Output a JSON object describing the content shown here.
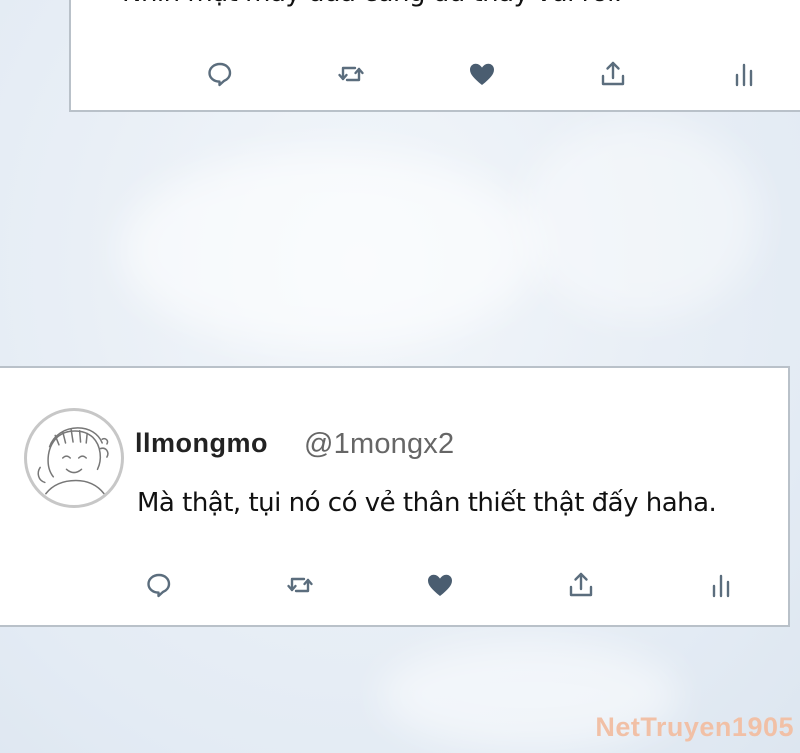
{
  "colors": {
    "card_border": "#b9c1c9",
    "icon": "#5b6d7d",
    "heart": "#4a5d70",
    "name": "#222222",
    "handle": "#666666",
    "watermark": "#f1c0a6"
  },
  "top_tweet": {
    "text": "Nhìn mặt mấy đứa cũng đủ thấy vui rồi.",
    "actions": [
      "reply-icon",
      "retweet-icon",
      "like-icon",
      "share-icon",
      "analytics-icon"
    ]
  },
  "reply_tweet": {
    "display_name": "llmongmo",
    "handle": "@1mongx2",
    "text": "Mà thật, tụi nó có vẻ thân thiết thật đấy haha.",
    "actions": [
      "reply-icon",
      "retweet-icon",
      "like-icon",
      "share-icon",
      "analytics-icon"
    ]
  },
  "watermark": "NetTruyen1905"
}
